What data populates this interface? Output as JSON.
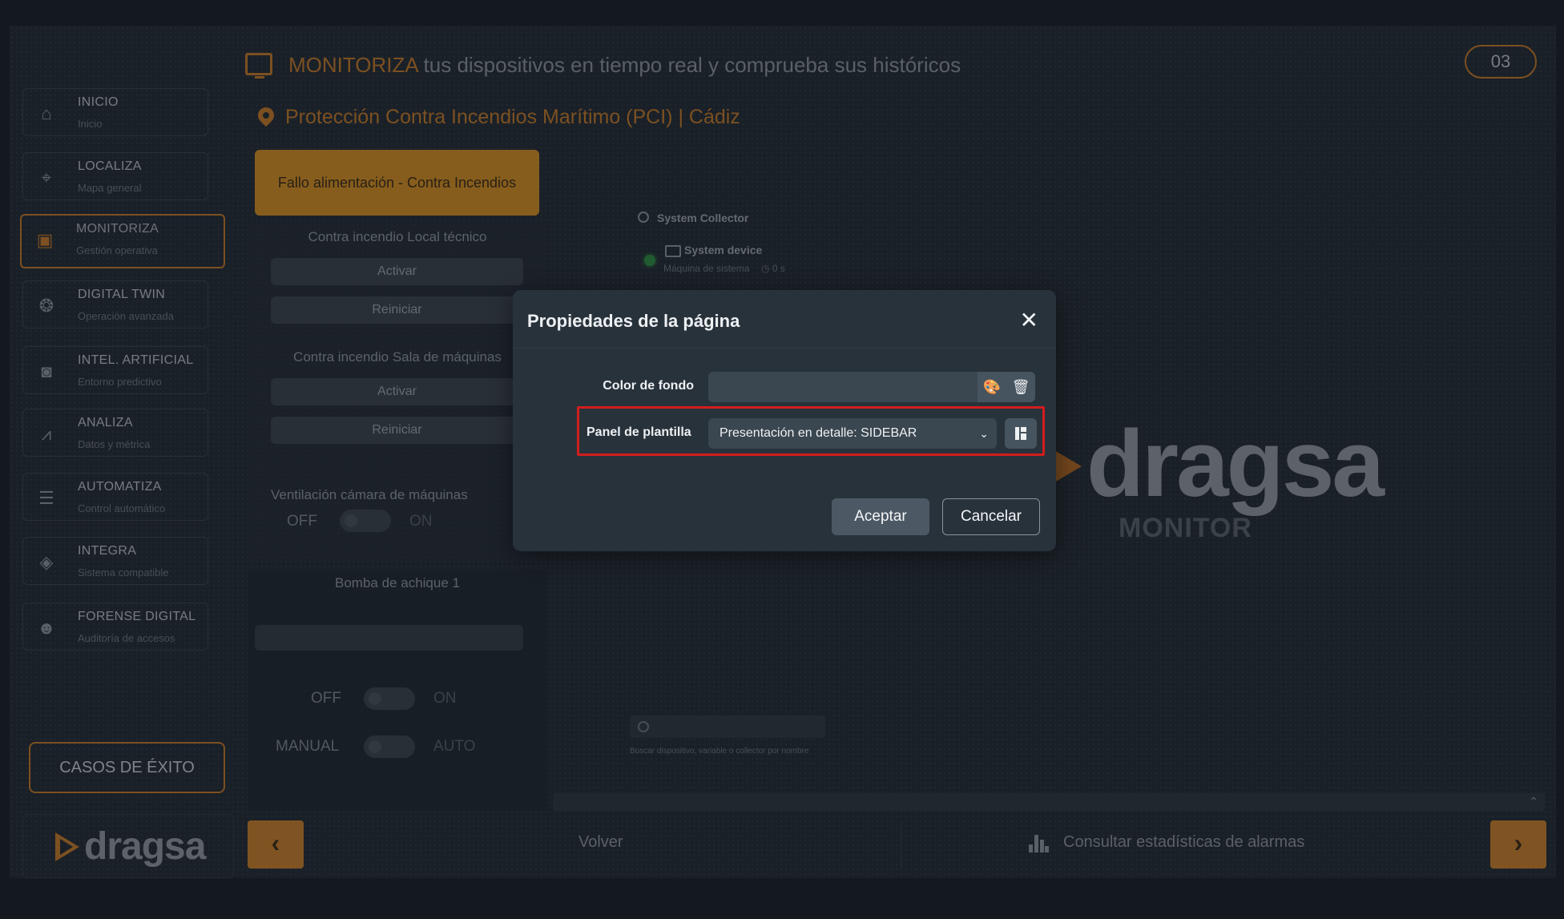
{
  "header": {
    "title_accent": "MONITORIZA",
    "title_rest": " tus dispositivos en tiempo real y comprueba sus históricos",
    "page_number": "03",
    "location": "Protección Contra Incendios Marítimo (PCI) | Cádiz"
  },
  "sidebar": {
    "items": [
      {
        "title": "INICIO",
        "subtitle": "Inicio"
      },
      {
        "title": "LOCALIZA",
        "subtitle": "Mapa general"
      },
      {
        "title": "MONITORIZA",
        "subtitle": "Gestión operativa"
      },
      {
        "title": "DIGITAL TWIN",
        "subtitle": "Operación avanzada"
      },
      {
        "title": "INTEL. ARTIFICIAL",
        "subtitle": "Entorno predictivo"
      },
      {
        "title": "ANALIZA",
        "subtitle": "Datos y métrica"
      },
      {
        "title": "AUTOMATIZA",
        "subtitle": "Control automático"
      },
      {
        "title": "INTEGRA",
        "subtitle": "Sistema compatible"
      },
      {
        "title": "FORENSE DIGITAL",
        "subtitle": "Auditoría de accesos"
      }
    ],
    "success_button": "CASOS DE ÉXITO",
    "logo_text": "dragsa"
  },
  "panel": {
    "alarm": "Fallo alimentación  - Contra Incendios",
    "group1_label": "Contra incendio Local técnico",
    "group2_label": "Contra incendio Sala de máquinas",
    "activate": "Activar",
    "restart": "Reiniciar",
    "ventilation_label": "Ventilación cámara de máquinas",
    "pump_label": "Bomba de achique 1",
    "off": "OFF",
    "on": "ON",
    "manual": "MANUAL",
    "auto": "AUTO"
  },
  "right": {
    "collector": "System Collector",
    "device": "System device",
    "device_sub": "Máquina de sistema",
    "device_time": "0 s",
    "logo_text": "dragsa",
    "logo_sub": "MONITOR",
    "search_help": "Buscar dispositivo, variable o collector por nombre"
  },
  "footer": {
    "back": "Volver",
    "stats": "Consultar estadísticas de alarmas",
    "prev_glyph": "‹",
    "next_glyph": "›"
  },
  "modal": {
    "title": "Propiedades de la página",
    "close": "✕",
    "color_label": "Color de fondo",
    "template_label": "Panel de plantilla",
    "template_value": "Presentación en detalle: SIDEBAR",
    "accept": "Aceptar",
    "cancel": "Cancelar"
  },
  "colors": {
    "accent": "#c27a2b",
    "alarm": "#d38f25",
    "highlight": "#d21d1d",
    "status_ok": "#2f8c43"
  },
  "icons": [
    "home-icon",
    "map-pin-icon",
    "monitor-icon",
    "brain-icon",
    "ai-chip-icon",
    "chart-icon",
    "list-icon",
    "layers-icon",
    "users-icon",
    "palette-icon",
    "trash-icon",
    "template-icon",
    "search-icon",
    "stats-icon",
    "close-icon",
    "chevron-down-icon"
  ]
}
